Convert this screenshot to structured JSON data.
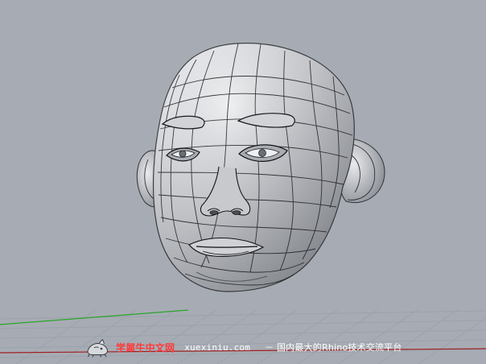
{
  "viewport": {
    "background_color": "#a7acb4",
    "grid_color": "#98a1aa",
    "x_axis_color": "#9f1f1f",
    "y_axis_color": "#2aa52a",
    "model": "head-wireframe-model"
  },
  "watermark": {
    "brand": "学犀牛中文网",
    "domain": "xuexiniu.com",
    "tagline": "－ 国内最大的Rhino技术交流平台",
    "logo_icon": "rhino-logo-icon"
  }
}
